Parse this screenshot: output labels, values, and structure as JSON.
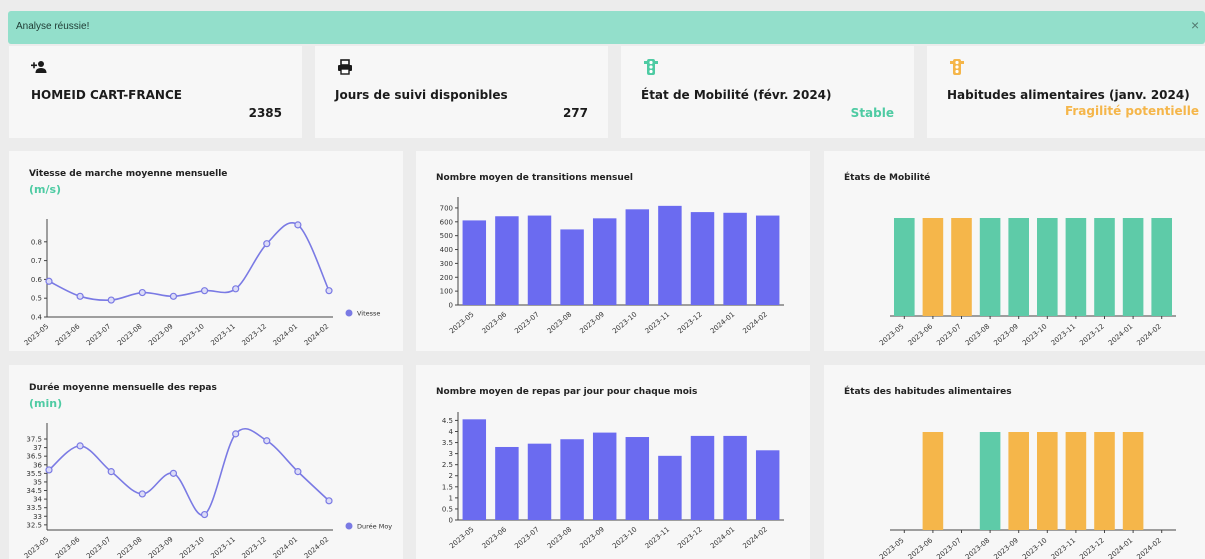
{
  "alert": {
    "message": "Analyse réussie!",
    "close_label": "×",
    "color": "#93dfcb"
  },
  "colors": {
    "accent": "#5ecba8",
    "warning": "#f5b64a",
    "bar": "#6b6bf0",
    "line": "#7a7ae4"
  },
  "stats": [
    {
      "icon": "user-plus-icon",
      "title": "HOMEID CART-FRANCE",
      "value": "2385",
      "value_color": "#1b1b1b"
    },
    {
      "icon": "printer-icon",
      "title": "Jours de suivi disponibles",
      "value": "277",
      "value_color": "#1b1b1b"
    },
    {
      "icon": "traffic-light-icon",
      "icon_color": "#4ecba3",
      "title": "État de Mobilité (févr. 2024)",
      "value": "Stable",
      "value_color": "#4ecba3"
    },
    {
      "icon": "traffic-light-icon",
      "icon_color": "#f5b64a",
      "title": "Habitudes alimentaires (janv. 2024)",
      "value": "Fragilité potentielle",
      "value_color": "#f5b64a"
    }
  ],
  "chart_data": [
    {
      "type": "line",
      "title": "Vitesse de marche moyenne mensuelle",
      "unit": "(m/s)",
      "x": [
        "2023-05",
        "2023-06",
        "2023-07",
        "2023-08",
        "2023-09",
        "2023-10",
        "2023-11",
        "2023-12",
        "2024-01",
        "2024-02"
      ],
      "series": [
        {
          "name": "Vitesse",
          "values": [
            0.59,
            0.51,
            0.49,
            0.53,
            0.51,
            0.54,
            0.55,
            0.79,
            0.89,
            0.54
          ]
        }
      ],
      "ylim": [
        0.4,
        0.9
      ],
      "yticks": [
        "0.4",
        "0.5",
        "0.6",
        "0.7",
        "0.8"
      ],
      "legend": "right"
    },
    {
      "type": "bar",
      "title": "Nombre moyen de transitions mensuel",
      "categories": [
        "2023-05",
        "2023-06",
        "2023-07",
        "2023-08",
        "2023-09",
        "2023-10",
        "2023-11",
        "2023-12",
        "2024-01",
        "2024-02"
      ],
      "values": [
        610,
        640,
        645,
        545,
        625,
        690,
        715,
        670,
        665,
        645
      ],
      "ylim": [
        0,
        750
      ],
      "yticks": [
        "0",
        "100",
        "200",
        "300",
        "400",
        "500",
        "600",
        "700"
      ]
    },
    {
      "type": "bar",
      "title": "États de Mobilité",
      "categories": [
        "2023-05",
        "2023-06",
        "2023-07",
        "2023-08",
        "2023-09",
        "2023-10",
        "2023-11",
        "2023-12",
        "2024-01",
        "2024-02"
      ],
      "states": [
        "stable",
        "warning",
        "warning",
        "stable",
        "stable",
        "stable",
        "stable",
        "stable",
        "stable",
        "stable"
      ]
    },
    {
      "type": "line",
      "title": "Durée moyenne mensuelle des repas",
      "unit": "(min)",
      "x": [
        "2023-05",
        "2023-06",
        "2023-07",
        "2023-08",
        "2023-09",
        "2023-10",
        "2023-11",
        "2023-12",
        "2024-01",
        "2024-02"
      ],
      "series": [
        {
          "name": "Durée Moy",
          "values": [
            35.7,
            37.1,
            35.6,
            34.3,
            35.5,
            33.1,
            37.8,
            37.4,
            35.6,
            33.9
          ]
        }
      ],
      "ylim": [
        32.2,
        38.2
      ],
      "yticks": [
        "32.5",
        "33",
        "33.5",
        "34",
        "34.5",
        "35",
        "35.5",
        "36",
        "36.5",
        "37",
        "37.5"
      ],
      "legend": "right"
    },
    {
      "type": "bar",
      "title": "Nombre moyen de repas par jour pour chaque mois",
      "categories": [
        "2023-05",
        "2023-06",
        "2023-07",
        "2023-08",
        "2023-09",
        "2023-10",
        "2023-11",
        "2023-12",
        "2024-01",
        "2024-02"
      ],
      "values": [
        4.55,
        3.3,
        3.45,
        3.65,
        3.95,
        3.75,
        2.9,
        3.8,
        3.8,
        3.15
      ],
      "ylim": [
        0,
        4.7
      ],
      "yticks": [
        "0",
        "0.5",
        "1",
        "1.5",
        "2",
        "2.5",
        "3",
        "3.5",
        "4",
        "4.5"
      ]
    },
    {
      "type": "bar",
      "title": "États des habitudes alimentaires",
      "categories": [
        "2023-05",
        "2023-06",
        "2023-07",
        "2023-08",
        "2023-09",
        "2023-10",
        "2023-11",
        "2023-12",
        "2024-01",
        "2024-02"
      ],
      "states": [
        "none",
        "warning",
        "none",
        "stable",
        "warning",
        "warning",
        "warning",
        "warning",
        "warning",
        "none"
      ]
    }
  ]
}
